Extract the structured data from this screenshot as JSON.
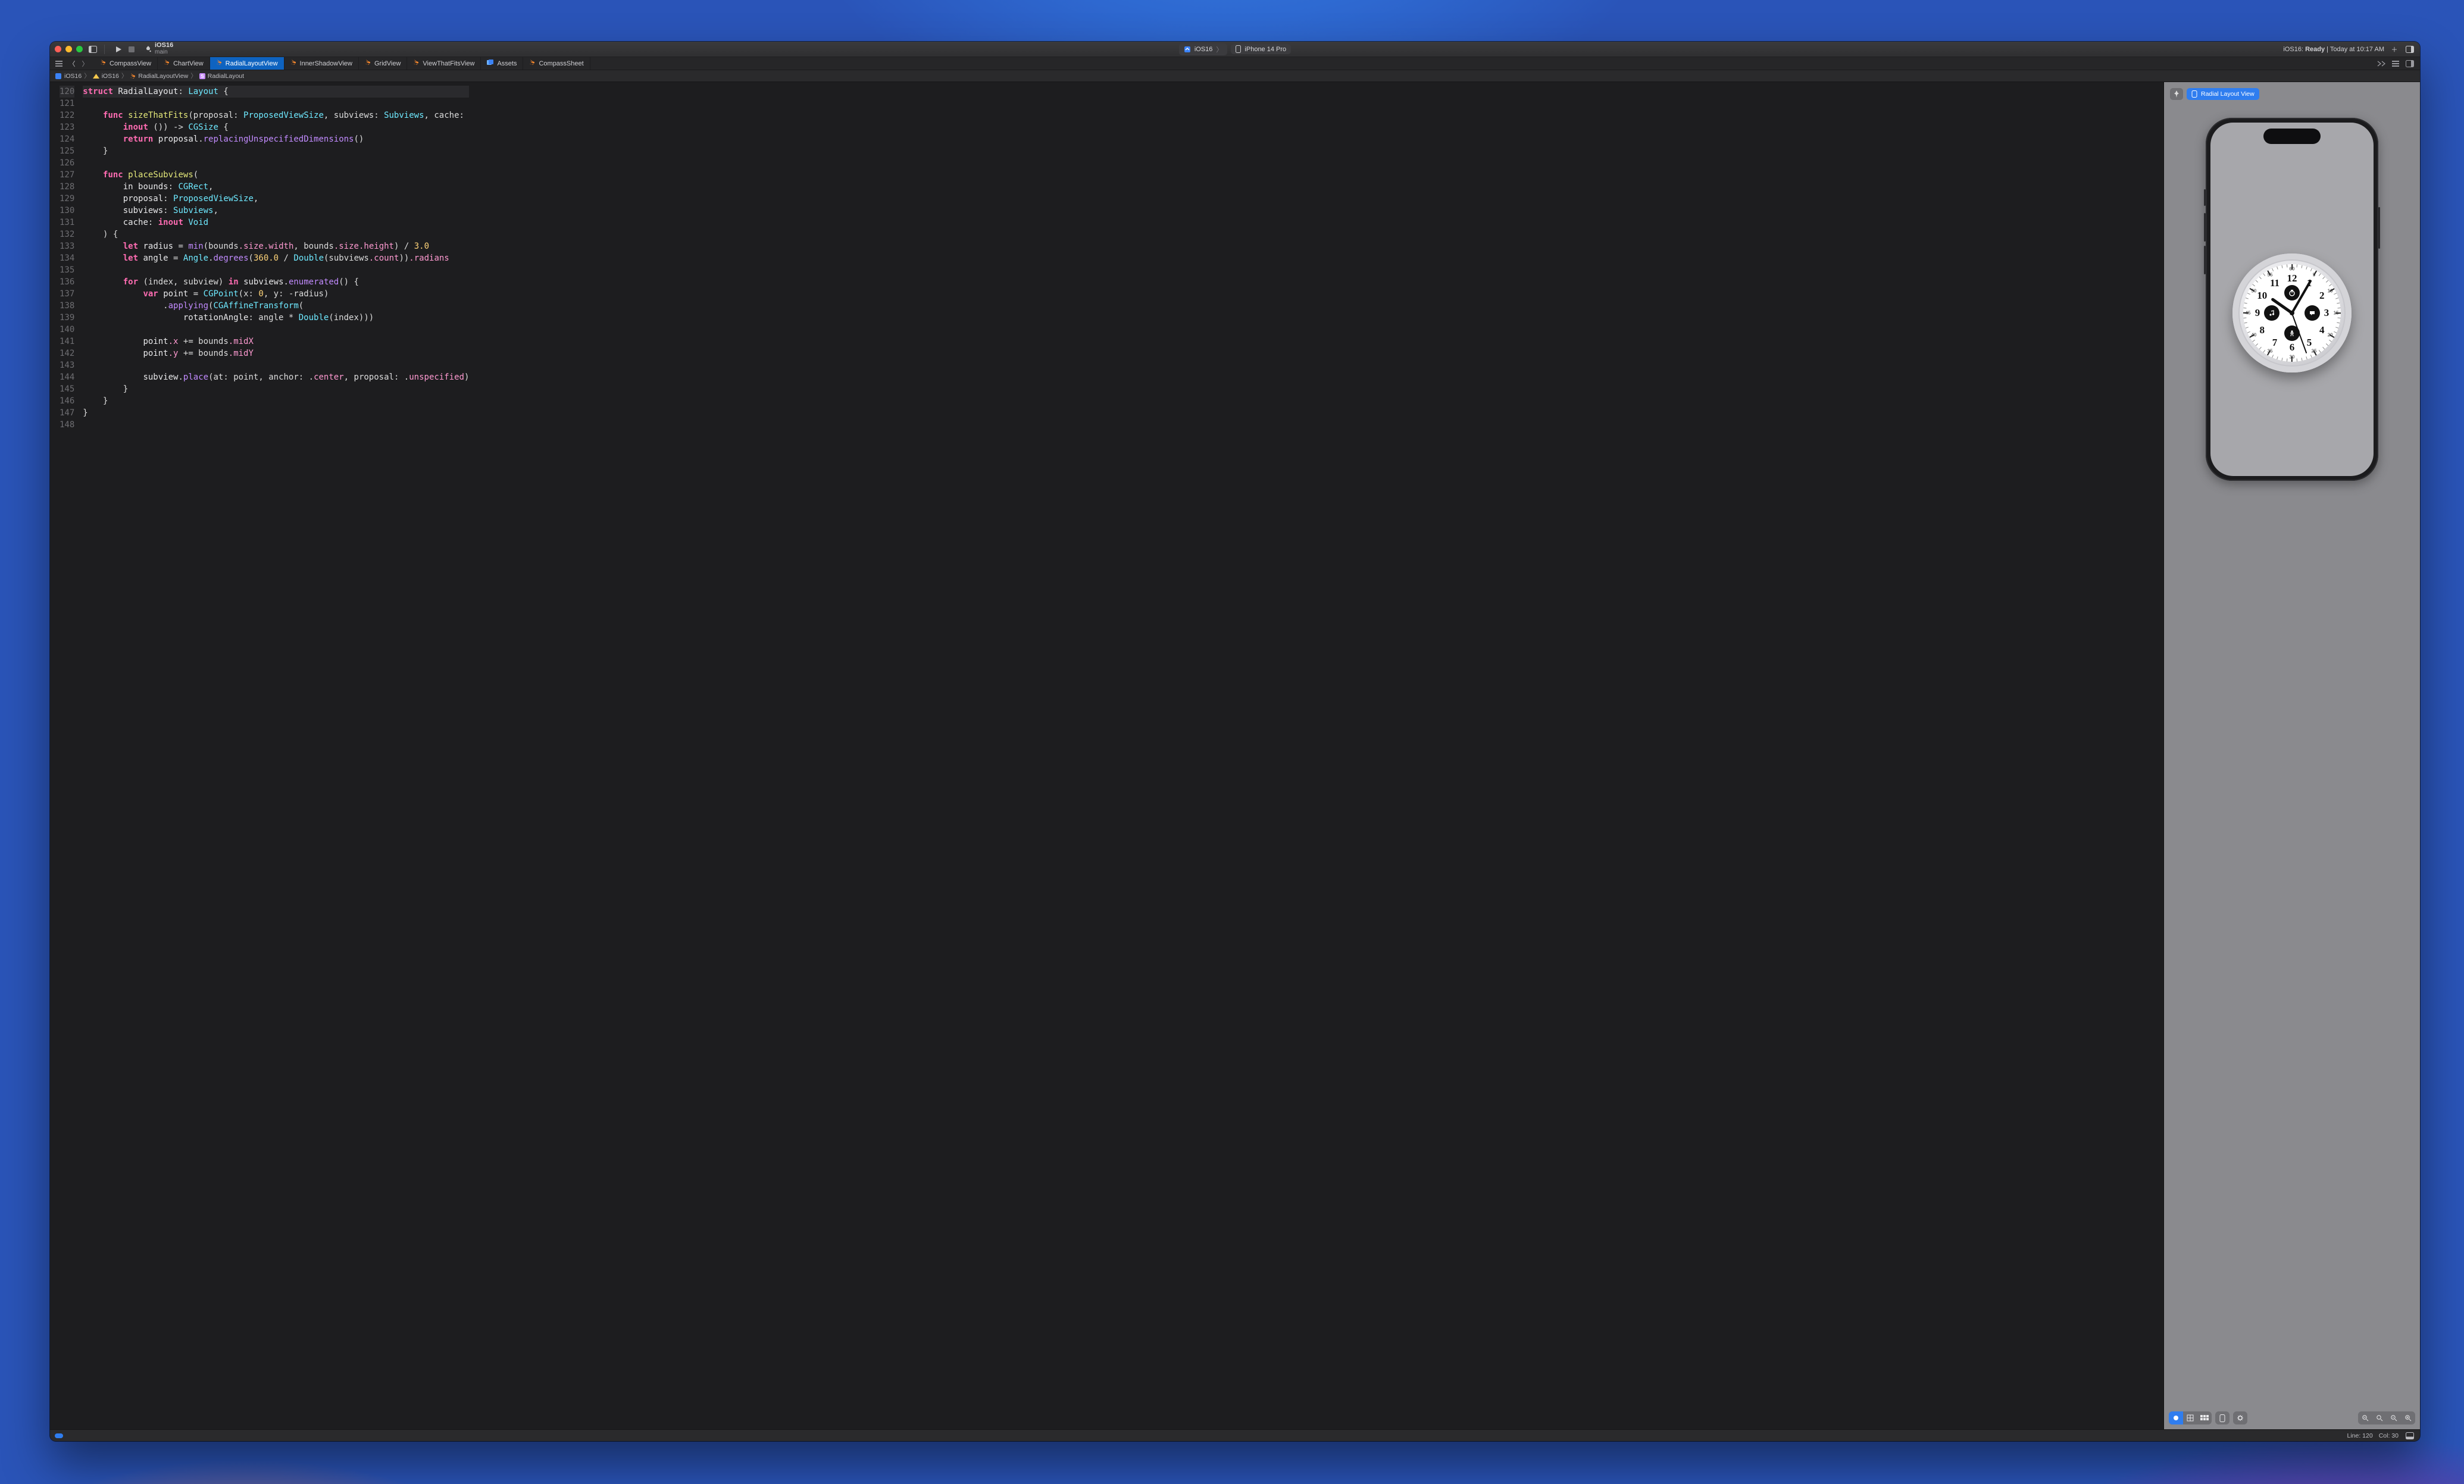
{
  "scheme": {
    "name": "iOS16",
    "branch": "main"
  },
  "target": {
    "project": "iOS16",
    "device": "iPhone 14 Pro"
  },
  "status": {
    "prefix": "iOS16:",
    "state": "Ready",
    "suffix": "| Today at 10:17 AM"
  },
  "tabs": [
    {
      "label": "CompassView",
      "icon": "swift"
    },
    {
      "label": "ChartView",
      "icon": "swift"
    },
    {
      "label": "RadialLayoutView",
      "icon": "swift",
      "active": true
    },
    {
      "label": "InnerShadowView",
      "icon": "swift"
    },
    {
      "label": "GridView",
      "icon": "swift"
    },
    {
      "label": "ViewThatFitsView",
      "icon": "swift"
    },
    {
      "label": "Assets",
      "icon": "assets"
    },
    {
      "label": "CompassSheet",
      "icon": "swift"
    }
  ],
  "path": {
    "project": "iOS16",
    "group": "iOS16",
    "file": "RadialLayoutView",
    "symbol": "RadialLayout"
  },
  "code": {
    "first_line": 120,
    "lines": [
      [
        [
          "kw",
          "struct"
        ],
        [
          "sp",
          " "
        ],
        [
          "id",
          "RadialLayout"
        ],
        [
          "pu",
          ": "
        ],
        [
          "ty",
          "Layout"
        ],
        [
          "pu",
          " {"
        ]
      ],
      [],
      [
        [
          "sp",
          "    "
        ],
        [
          "kw",
          "func"
        ],
        [
          "sp",
          " "
        ],
        [
          "fn",
          "sizeThatFits"
        ],
        [
          "pu",
          "(proposal: "
        ],
        [
          "ty",
          "ProposedViewSize"
        ],
        [
          "pu",
          ", subviews: "
        ],
        [
          "ty",
          "Subviews"
        ],
        [
          "pu",
          ", cache:"
        ]
      ],
      [
        [
          "sp",
          "        "
        ],
        [
          "kw",
          "inout"
        ],
        [
          "pu",
          " ()) -> "
        ],
        [
          "ty",
          "CGSize"
        ],
        [
          "pu",
          " {"
        ]
      ],
      [
        [
          "sp",
          "        "
        ],
        [
          "kw",
          "return"
        ],
        [
          "sp",
          " "
        ],
        [
          "id",
          "proposal"
        ],
        [
          "pu",
          "."
        ],
        [
          "call",
          "replacingUnspecifiedDimensions"
        ],
        [
          "pu",
          "()"
        ]
      ],
      [
        [
          "sp",
          "    "
        ],
        [
          "pu",
          "}"
        ]
      ],
      [],
      [
        [
          "sp",
          "    "
        ],
        [
          "kw",
          "func"
        ],
        [
          "sp",
          " "
        ],
        [
          "fn",
          "placeSubviews"
        ],
        [
          "pu",
          "("
        ]
      ],
      [
        [
          "sp",
          "        "
        ],
        [
          "id",
          "in"
        ],
        [
          "sp",
          " "
        ],
        [
          "id",
          "bounds"
        ],
        [
          "pu",
          ": "
        ],
        [
          "ty",
          "CGRect"
        ],
        [
          "pu",
          ","
        ]
      ],
      [
        [
          "sp",
          "        "
        ],
        [
          "id",
          "proposal"
        ],
        [
          "pu",
          ": "
        ],
        [
          "ty",
          "ProposedViewSize"
        ],
        [
          "pu",
          ","
        ]
      ],
      [
        [
          "sp",
          "        "
        ],
        [
          "id",
          "subviews"
        ],
        [
          "pu",
          ": "
        ],
        [
          "ty",
          "Subviews"
        ],
        [
          "pu",
          ","
        ]
      ],
      [
        [
          "sp",
          "        "
        ],
        [
          "id",
          "cache"
        ],
        [
          "pu",
          ": "
        ],
        [
          "kw",
          "inout"
        ],
        [
          "sp",
          " "
        ],
        [
          "ty",
          "Void"
        ]
      ],
      [
        [
          "sp",
          "    "
        ],
        [
          "pu",
          ") {"
        ]
      ],
      [
        [
          "sp",
          "        "
        ],
        [
          "kw",
          "let"
        ],
        [
          "sp",
          " "
        ],
        [
          "id",
          "radius"
        ],
        [
          "pu",
          " = "
        ],
        [
          "call",
          "min"
        ],
        [
          "pu",
          "(bounds"
        ],
        [
          "mem",
          ".size"
        ],
        [
          "mem",
          ".width"
        ],
        [
          "pu",
          ", bounds"
        ],
        [
          "mem",
          ".size"
        ],
        [
          "mem",
          ".height"
        ],
        [
          "pu",
          ") / "
        ],
        [
          "num",
          "3.0"
        ]
      ],
      [
        [
          "sp",
          "        "
        ],
        [
          "kw",
          "let"
        ],
        [
          "sp",
          " "
        ],
        [
          "id",
          "angle"
        ],
        [
          "pu",
          " = "
        ],
        [
          "ty",
          "Angle"
        ],
        [
          "pu",
          "."
        ],
        [
          "call",
          "degrees"
        ],
        [
          "pu",
          "("
        ],
        [
          "num",
          "360.0"
        ],
        [
          "pu",
          " / "
        ],
        [
          "ty",
          "Double"
        ],
        [
          "pu",
          "(subviews"
        ],
        [
          "mem",
          ".count"
        ],
        [
          "pu",
          "))"
        ],
        [
          "mem",
          ".radians"
        ]
      ],
      [],
      [
        [
          "sp",
          "        "
        ],
        [
          "kw",
          "for"
        ],
        [
          "sp",
          " "
        ],
        [
          "pu",
          "(index, subview) "
        ],
        [
          "kw",
          "in"
        ],
        [
          "sp",
          " "
        ],
        [
          "id",
          "subviews"
        ],
        [
          "pu",
          "."
        ],
        [
          "call",
          "enumerated"
        ],
        [
          "pu",
          "() {"
        ]
      ],
      [
        [
          "sp",
          "            "
        ],
        [
          "kw",
          "var"
        ],
        [
          "sp",
          " "
        ],
        [
          "id",
          "point"
        ],
        [
          "pu",
          " = "
        ],
        [
          "ty",
          "CGPoint"
        ],
        [
          "pu",
          "(x: "
        ],
        [
          "num",
          "0"
        ],
        [
          "pu",
          ", y: -radius)"
        ]
      ],
      [
        [
          "sp",
          "                "
        ],
        [
          "pu",
          "."
        ],
        [
          "call",
          "applying"
        ],
        [
          "pu",
          "("
        ],
        [
          "ty",
          "CGAffineTransform"
        ],
        [
          "pu",
          "("
        ]
      ],
      [
        [
          "sp",
          "                    "
        ],
        [
          "id",
          "rotationAngle"
        ],
        [
          "pu",
          ": angle * "
        ],
        [
          "ty",
          "Double"
        ],
        [
          "pu",
          "(index)))"
        ]
      ],
      [],
      [
        [
          "sp",
          "            "
        ],
        [
          "id",
          "point"
        ],
        [
          "mem",
          ".x"
        ],
        [
          "pu",
          " += bounds"
        ],
        [
          "mem",
          ".midX"
        ]
      ],
      [
        [
          "sp",
          "            "
        ],
        [
          "id",
          "point"
        ],
        [
          "mem",
          ".y"
        ],
        [
          "pu",
          " += bounds"
        ],
        [
          "mem",
          ".midY"
        ]
      ],
      [],
      [
        [
          "sp",
          "            "
        ],
        [
          "id",
          "subview"
        ],
        [
          "pu",
          "."
        ],
        [
          "call",
          "place"
        ],
        [
          "pu",
          "(at: point, anchor: ."
        ],
        [
          "mem",
          "center"
        ],
        [
          "pu",
          ", proposal: ."
        ],
        [
          "mem",
          "unspecified"
        ],
        [
          "pu",
          ")"
        ]
      ],
      [
        [
          "sp",
          "        "
        ],
        [
          "pu",
          "}"
        ]
      ],
      [
        [
          "sp",
          "    "
        ],
        [
          "pu",
          "}"
        ]
      ],
      [
        [
          "pu",
          "}"
        ]
      ],
      []
    ]
  },
  "preview": {
    "chip": "Radial Layout View"
  },
  "clock": {
    "hours": [
      "12",
      "1",
      "2",
      "3",
      "4",
      "5",
      "6",
      "7",
      "8",
      "9",
      "10",
      "11"
    ],
    "minutes": [
      "60",
      "5",
      "10",
      "15",
      "20",
      "25",
      "30",
      "35",
      "40",
      "45",
      "50",
      "55"
    ]
  },
  "statusbar": {
    "line": "Line: 120",
    "col": "Col: 30"
  }
}
